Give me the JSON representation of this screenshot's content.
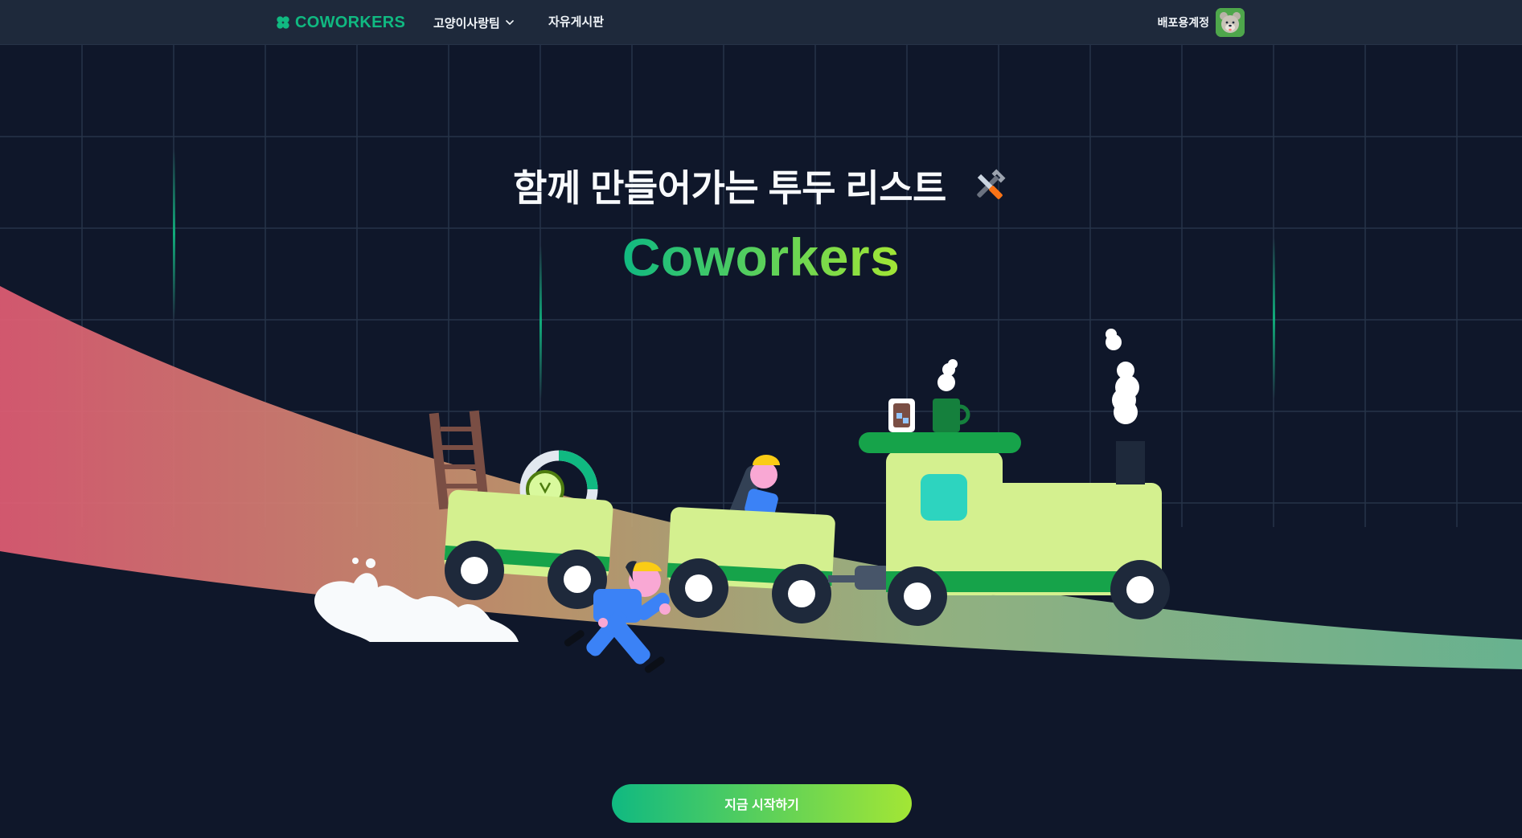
{
  "header": {
    "logo_text": "COWORKERS",
    "logo_icon": "clover-icon",
    "team_menu_label": "고양이사랑팀",
    "team_menu_icon": "chevron-down-icon",
    "board_link_label": "자유게시판",
    "account_name": "배포용계정",
    "avatar_icon": "bear-avatar"
  },
  "hero": {
    "title": "함께 만들어가는 투두 리스트",
    "title_icon": "tools-icon",
    "brand": "Coworkers",
    "illustration": "train-workers-illustration"
  },
  "cta": {
    "label": "지금 시작하기"
  },
  "colors": {
    "background": "#0f172a",
    "topbar": "#1e293b",
    "brand_green": "#10b981",
    "brand_lime": "#a3e635"
  }
}
